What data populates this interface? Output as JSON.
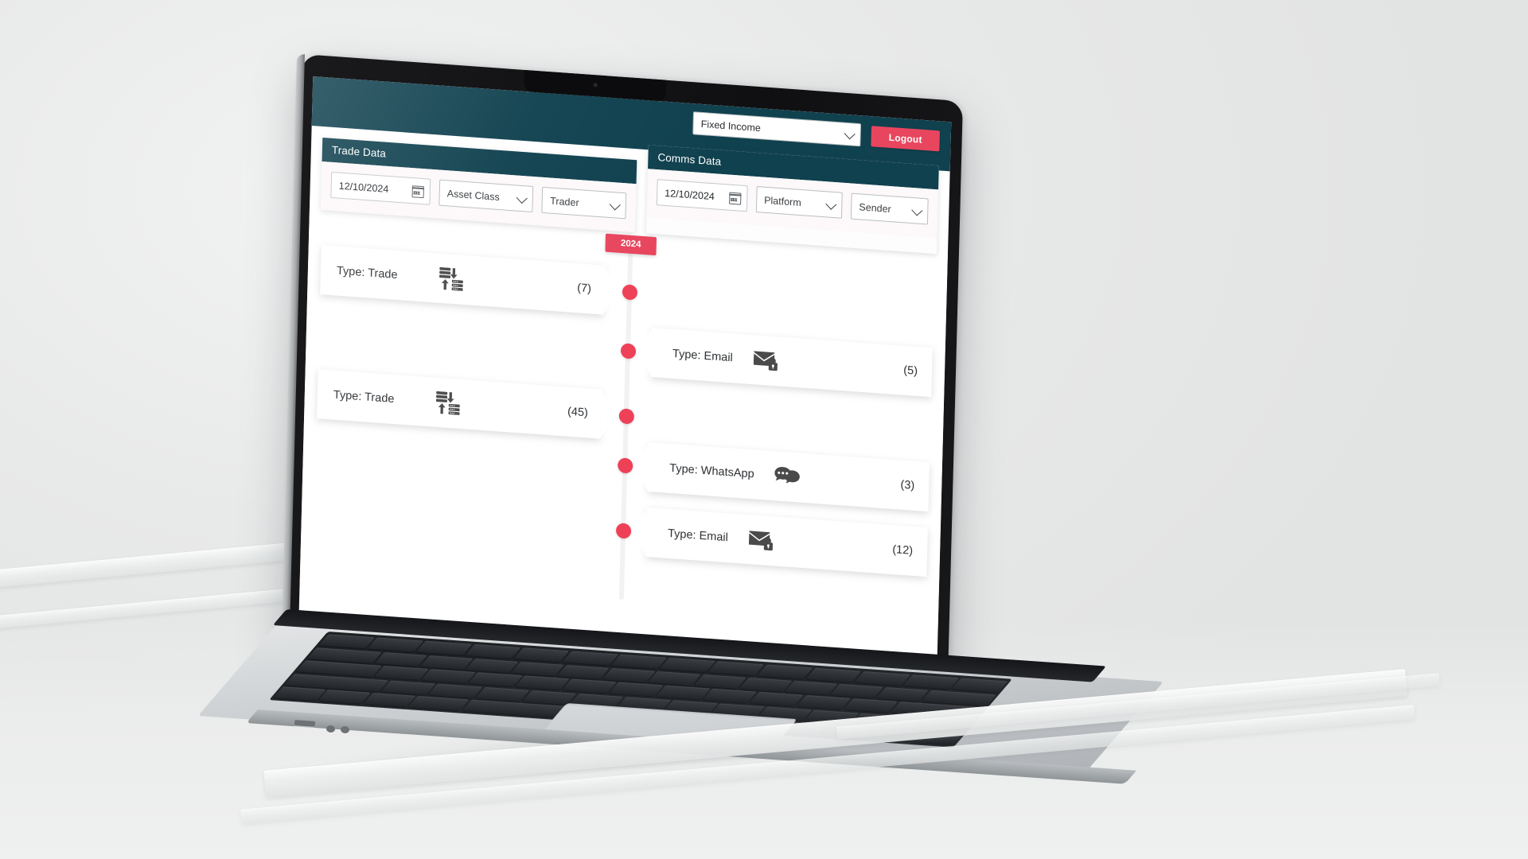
{
  "app": {
    "topbar": {
      "asset_selector_value": "Fixed Income",
      "asset_selector_icon": "chevron-down-icon",
      "logout_label": "Logout"
    },
    "panels": [
      {
        "id": "trade-data",
        "title": "Trade Data",
        "date_value": "12/10/2024",
        "date_icon": "calendar-icon",
        "filters": [
          {
            "id": "asset-class",
            "value": "Asset Class",
            "icon": "chevron-down-icon"
          },
          {
            "id": "trader",
            "value": "Trader",
            "icon": "chevron-down-icon"
          }
        ]
      },
      {
        "id": "comms-data",
        "title": "Comms Data",
        "date_value": "12/10/2024",
        "date_icon": "calendar-icon",
        "filters": [
          {
            "id": "platform",
            "value": "Platform",
            "icon": "chevron-down-icon"
          },
          {
            "id": "sender",
            "value": "Sender",
            "icon": "chevron-down-icon"
          }
        ]
      }
    ],
    "timeline": {
      "year_badge": "2024",
      "events": [
        {
          "side": "left",
          "label": "Type: Trade",
          "count": "(7)",
          "icon": "data-exchange-icon"
        },
        {
          "side": "right",
          "label": "Type: Email",
          "count": "(5)",
          "icon": "secure-email-icon"
        },
        {
          "side": "left",
          "label": "Type: Trade",
          "count": "(45)",
          "icon": "data-exchange-icon"
        },
        {
          "side": "right",
          "label": "Type: WhatsApp",
          "count": "(3)",
          "icon": "chat-bubbles-icon"
        },
        {
          "side": "right",
          "label": "Type: Email",
          "count": "(12)",
          "icon": "secure-email-icon"
        }
      ]
    },
    "colors": {
      "header_teal": "#10414f",
      "accent_crimson": "#e8465e",
      "dot_crimson": "#ee4158",
      "filter_bg": "#fdf8f9",
      "page_bg": "#ffffff"
    }
  }
}
